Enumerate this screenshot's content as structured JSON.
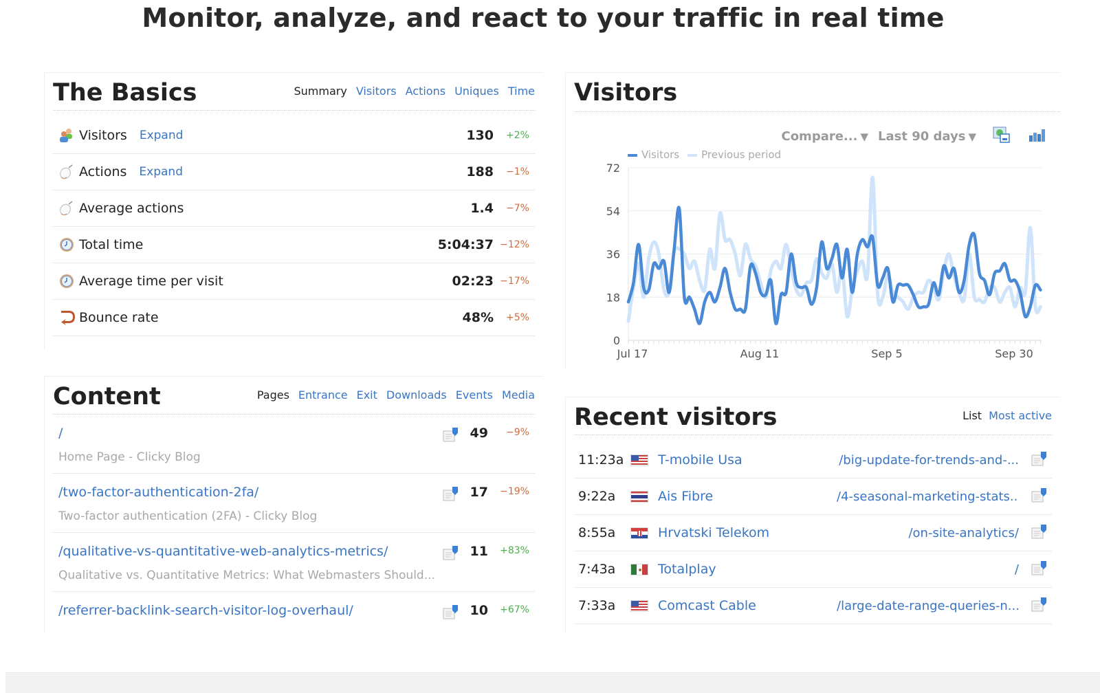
{
  "headline": "Monitor, analyze, and react to your traffic in real time",
  "basics": {
    "title": "The Basics",
    "tabs": [
      {
        "label": "Summary",
        "active": true
      },
      {
        "label": "Visitors",
        "active": false
      },
      {
        "label": "Actions",
        "active": false
      },
      {
        "label": "Uniques",
        "active": false
      },
      {
        "label": "Time",
        "active": false
      }
    ],
    "rows": [
      {
        "icon": "visitors-icon",
        "label": "Visitors",
        "expand": "Expand",
        "value": "130",
        "change": "+2%",
        "trend": "pos"
      },
      {
        "icon": "mouse-icon",
        "label": "Actions",
        "expand": "Expand",
        "value": "188",
        "change": "−1%",
        "trend": "neg"
      },
      {
        "icon": "mouse-icon",
        "label": "Average actions",
        "expand": "",
        "value": "1.4",
        "change": "−7%",
        "trend": "neg"
      },
      {
        "icon": "clock-icon",
        "label": "Total time",
        "expand": "",
        "value": "5:04:37",
        "change": "−12%",
        "trend": "neg"
      },
      {
        "icon": "clock-icon",
        "label": "Average time per visit",
        "expand": "",
        "value": "02:23",
        "change": "−17%",
        "trend": "neg"
      },
      {
        "icon": "bounce-icon",
        "label": "Bounce rate",
        "expand": "",
        "value": "48%",
        "change": "+5%",
        "trend": "neg"
      }
    ]
  },
  "content": {
    "title": "Content",
    "tabs": [
      {
        "label": "Pages",
        "active": true
      },
      {
        "label": "Entrance",
        "active": false
      },
      {
        "label": "Exit",
        "active": false
      },
      {
        "label": "Downloads",
        "active": false
      },
      {
        "label": "Events",
        "active": false
      },
      {
        "label": "Media",
        "active": false
      }
    ],
    "rows": [
      {
        "path": "/",
        "title": "Home Page - Clicky Blog",
        "count": "49",
        "change": "−9%",
        "trend": "neg"
      },
      {
        "path": "/two-factor-authentication-2fa/",
        "title": "Two-factor authentication (2FA) - Clicky Blog",
        "count": "17",
        "change": "−19%",
        "trend": "neg"
      },
      {
        "path": "/qualitative-vs-quantitative-web-analytics-metrics/",
        "title": "Qualitative vs. Quantitative Metrics: What Webmasters Should...",
        "count": "11",
        "change": "+83%",
        "trend": "pos"
      },
      {
        "path": "/referrer-backlink-search-visitor-log-overhaul/",
        "title": "",
        "count": "10",
        "change": "+67%",
        "trend": "pos"
      }
    ]
  },
  "visitors_panel": {
    "title": "Visitors",
    "compare_label": "Compare...",
    "range_label": "Last 90 days",
    "export_icon": "export-image-icon",
    "chart_type_icon": "bar-chart-icon"
  },
  "recent": {
    "title": "Recent visitors",
    "tabs": [
      {
        "label": "List",
        "active": true
      },
      {
        "label": "Most active",
        "active": false
      }
    ],
    "rows": [
      {
        "time": "11:23a",
        "flag": "us",
        "isp": "T-mobile Usa",
        "path": "/big-update-for-trends-and-..."
      },
      {
        "time": "9:22a",
        "flag": "th",
        "isp": "Ais Fibre",
        "path": "/4-seasonal-marketing-stats..."
      },
      {
        "time": "8:55a",
        "flag": "hr",
        "isp": "Hrvatski Telekom",
        "path": "/on-site-analytics/"
      },
      {
        "time": "7:43a",
        "flag": "mx",
        "isp": "Totalplay",
        "path": "/"
      },
      {
        "time": "7:33a",
        "flag": "us",
        "isp": "Comcast Cable",
        "path": "/large-date-range-queries-n..."
      }
    ]
  },
  "colors": {
    "link": "#3a75c4",
    "positive": "#4caf50",
    "negative": "#d06b3c",
    "series_current": "#4a89d6",
    "series_previous": "#cfe4fa"
  },
  "chart_data": {
    "type": "line",
    "title": "Visitors",
    "xlabel": "",
    "ylabel": "",
    "ylim": [
      0,
      72
    ],
    "yticks": [
      0,
      18,
      36,
      54,
      72
    ],
    "xtick_labels": [
      {
        "label": "Jul 17",
        "index": 0
      },
      {
        "label": "Aug 11",
        "index": 25
      },
      {
        "label": "Sep 5",
        "index": 50
      },
      {
        "label": "Sep 30",
        "index": 75
      }
    ],
    "grid": true,
    "legend": "top-left",
    "x_start": "Jul 17",
    "x_step": "1 day",
    "series": [
      {
        "name": "Visitors",
        "values": [
          16,
          24,
          40,
          22,
          21,
          32,
          30,
          33,
          20,
          38,
          55,
          18,
          18,
          13,
          7,
          16,
          20,
          16,
          22,
          30,
          20,
          13,
          13,
          13,
          31,
          28,
          20,
          19,
          25,
          7,
          19,
          20,
          36,
          24,
          22,
          22,
          15,
          22,
          41,
          30,
          34,
          40,
          26,
          38,
          20,
          36,
          42,
          39,
          43,
          23,
          26,
          30,
          16,
          23,
          23,
          23,
          19,
          14,
          14,
          15,
          24,
          19,
          31,
          26,
          30,
          20,
          25,
          40,
          44,
          28,
          25,
          19,
          28,
          29,
          32,
          25,
          25,
          20,
          10,
          14,
          23,
          21
        ]
      },
      {
        "name": "Previous period",
        "values": [
          8,
          22,
          32,
          18,
          34,
          41,
          36,
          21,
          20,
          37,
          38,
          36,
          30,
          33,
          25,
          21,
          38,
          30,
          53,
          42,
          42,
          36,
          27,
          40,
          34,
          31,
          24,
          18,
          29,
          33,
          30,
          40,
          30,
          21,
          19,
          24,
          25,
          34,
          28,
          26,
          32,
          20,
          30,
          10,
          21,
          29,
          33,
          27,
          68,
          19,
          18,
          27,
          20,
          18,
          16,
          13,
          18,
          20,
          20,
          25,
          22,
          17,
          29,
          36,
          27,
          20,
          17,
          36,
          18,
          17,
          16,
          22,
          22,
          16,
          20,
          22,
          14,
          22,
          20,
          47,
          14,
          14,
          14,
          12,
          17,
          16,
          28,
          12,
          31
        ]
      }
    ]
  }
}
